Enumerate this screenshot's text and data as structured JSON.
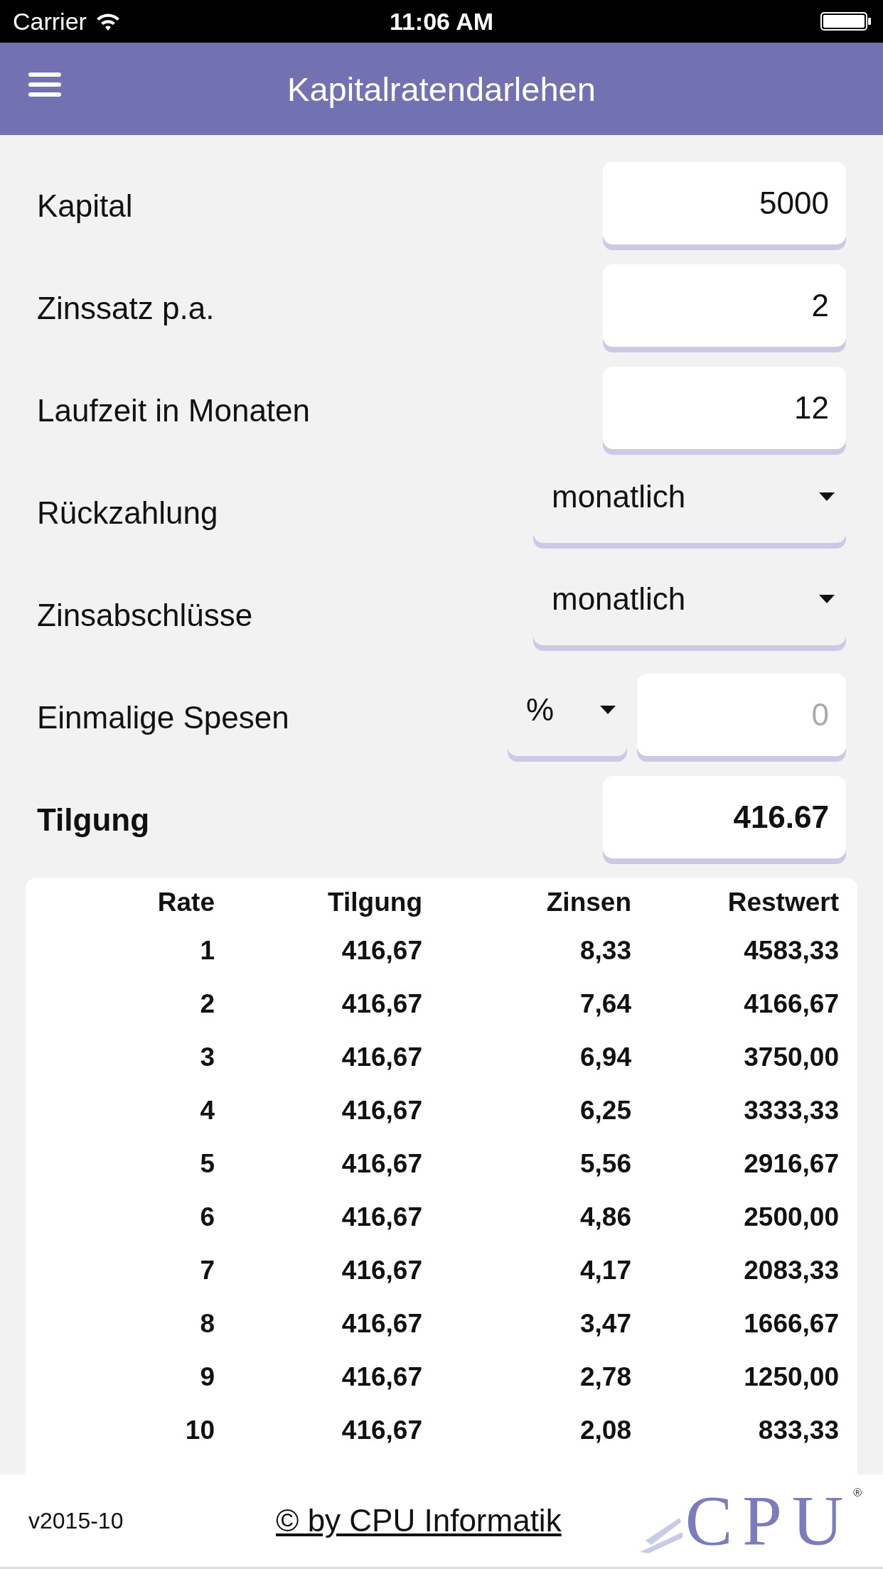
{
  "status_bar": {
    "carrier": "Carrier",
    "time": "11:06 AM"
  },
  "header": {
    "title": "Kapitalratendarlehen"
  },
  "form": [
    {
      "kind": "input",
      "label": "Kapital",
      "value": "5000"
    },
    {
      "kind": "input",
      "label": "Zinssatz p.a.",
      "value": "2"
    },
    {
      "kind": "input",
      "label": "Laufzeit in Monaten",
      "value": "12"
    },
    {
      "kind": "select",
      "label": "Rückzahlung",
      "value": "monatlich"
    },
    {
      "kind": "select",
      "label": "Zinsabschlüsse",
      "value": "monatlich"
    },
    {
      "kind": "unit_input",
      "label": "Einmalige Spesen",
      "unit": "%",
      "placeholder": "0"
    },
    {
      "kind": "result",
      "label": "Tilgung",
      "value": "416.67"
    }
  ],
  "table": {
    "columns": [
      "Rate",
      "Tilgung",
      "Zinsen",
      "Restwert"
    ],
    "rows": [
      [
        "1",
        "416,67",
        "8,33",
        "4583,33"
      ],
      [
        "2",
        "416,67",
        "7,64",
        "4166,67"
      ],
      [
        "3",
        "416,67",
        "6,94",
        "3750,00"
      ],
      [
        "4",
        "416,67",
        "6,25",
        "3333,33"
      ],
      [
        "5",
        "416,67",
        "5,56",
        "2916,67"
      ],
      [
        "6",
        "416,67",
        "4,86",
        "2500,00"
      ],
      [
        "7",
        "416,67",
        "4,17",
        "2083,33"
      ],
      [
        "8",
        "416,67",
        "3,47",
        "1666,67"
      ],
      [
        "9",
        "416,67",
        "2,78",
        "1250,00"
      ],
      [
        "10",
        "416,67",
        "2,08",
        "833,33"
      ]
    ]
  },
  "footer": {
    "version": "v2015-10",
    "link": "© by CPU Informatik",
    "logo": "CPU",
    "logo_mark": "®"
  }
}
